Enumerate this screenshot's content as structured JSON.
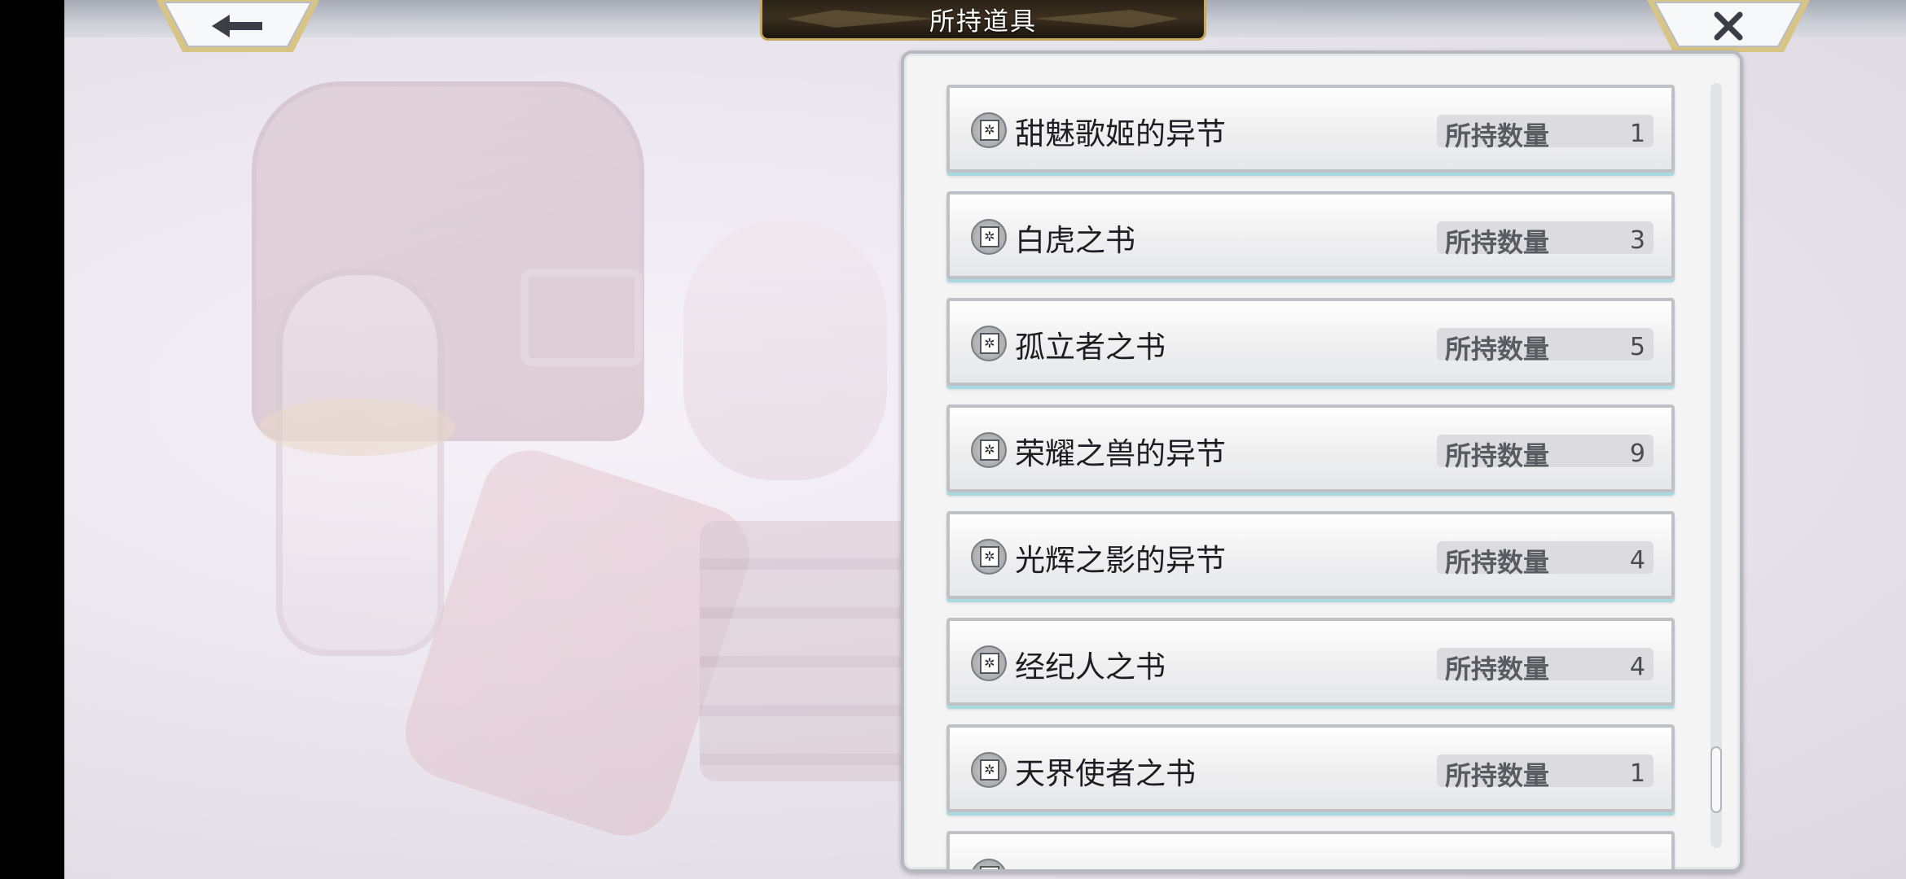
{
  "header": {
    "title": "所持道具",
    "back_icon": "back-arrow-icon",
    "close_icon": "close-x-icon"
  },
  "items_list": {
    "quantity_label": "所持数量",
    "item_icon": "book-icon",
    "items": [
      {
        "name": "甜魅歌姬的异节",
        "quantity": "1"
      },
      {
        "name": "白虎之书",
        "quantity": "3"
      },
      {
        "name": "孤立者之书",
        "quantity": "5"
      },
      {
        "name": "荣耀之兽的异节",
        "quantity": "9"
      },
      {
        "name": "光辉之影的异节",
        "quantity": "4"
      },
      {
        "name": "经纪人之书",
        "quantity": "4"
      },
      {
        "name": "天界使者之书",
        "quantity": "1"
      },
      {
        "name": "",
        "quantity": ""
      }
    ]
  },
  "scroll": {
    "position": 0.95
  },
  "colors": {
    "title_plate": "#2a2217",
    "title_border": "#c9a85c",
    "row_shadow_accent": "#a9d9e0",
    "corner_button_gold": "#d8c585"
  }
}
